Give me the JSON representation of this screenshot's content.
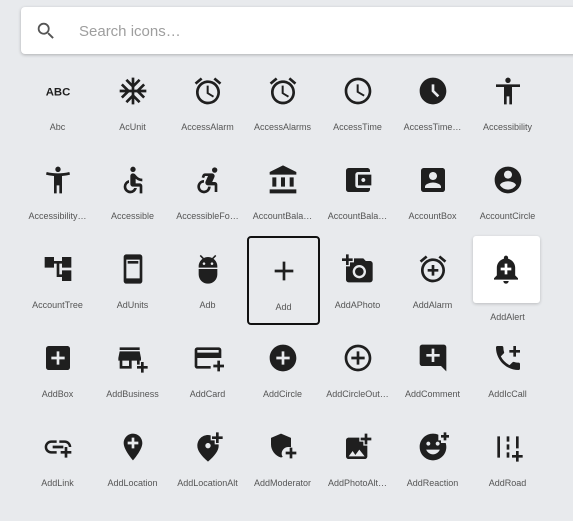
{
  "search": {
    "placeholder": "Search icons…",
    "value": ""
  },
  "icons": [
    {
      "label": "Abc",
      "icon": "abc-icon"
    },
    {
      "label": "AcUnit",
      "icon": "ac-unit-icon"
    },
    {
      "label": "AccessAlarm",
      "icon": "access-alarm-icon"
    },
    {
      "label": "AccessAlarms",
      "icon": "access-alarms-icon"
    },
    {
      "label": "AccessTime",
      "icon": "access-time-icon"
    },
    {
      "label": "AccessTime…",
      "icon": "access-time-filled-icon"
    },
    {
      "label": "Accessibility",
      "icon": "accessibility-icon"
    },
    {
      "label": "Accessibility…",
      "icon": "accessibility-new-icon"
    },
    {
      "label": "Accessible",
      "icon": "accessible-icon"
    },
    {
      "label": "AccessibleFo…",
      "icon": "accessible-forward-icon"
    },
    {
      "label": "AccountBala…",
      "icon": "account-balance-icon"
    },
    {
      "label": "AccountBala…",
      "icon": "account-balance-wallet-icon"
    },
    {
      "label": "AccountBox",
      "icon": "account-box-icon"
    },
    {
      "label": "AccountCircle",
      "icon": "account-circle-icon"
    },
    {
      "label": "AccountTree",
      "icon": "account-tree-icon"
    },
    {
      "label": "AdUnits",
      "icon": "ad-units-icon"
    },
    {
      "label": "Adb",
      "icon": "adb-icon"
    },
    {
      "label": "Add",
      "icon": "add-icon"
    },
    {
      "label": "AddAPhoto",
      "icon": "add-a-photo-icon"
    },
    {
      "label": "AddAlarm",
      "icon": "add-alarm-icon"
    },
    {
      "label": "AddAlert",
      "icon": "add-alert-icon"
    },
    {
      "label": "AddBox",
      "icon": "add-box-icon"
    },
    {
      "label": "AddBusiness",
      "icon": "add-business-icon"
    },
    {
      "label": "AddCard",
      "icon": "add-card-icon"
    },
    {
      "label": "AddCircle",
      "icon": "add-circle-icon"
    },
    {
      "label": "AddCircleOut…",
      "icon": "add-circle-outline-icon"
    },
    {
      "label": "AddComment",
      "icon": "add-comment-icon"
    },
    {
      "label": "AddIcCall",
      "icon": "add-ic-call-icon"
    },
    {
      "label": "AddLink",
      "icon": "add-link-icon"
    },
    {
      "label": "AddLocation",
      "icon": "add-location-icon"
    },
    {
      "label": "AddLocationAlt",
      "icon": "add-location-alt-icon"
    },
    {
      "label": "AddModerator",
      "icon": "add-moderator-icon"
    },
    {
      "label": "AddPhotoAlt…",
      "icon": "add-photo-alternate-icon"
    },
    {
      "label": "AddReaction",
      "icon": "add-reaction-icon"
    },
    {
      "label": "AddRoad",
      "icon": "add-road-icon"
    }
  ],
  "selected_label": "Add",
  "hovered_label": "AddAlert",
  "colors": {
    "background": "#e8eaed",
    "icon": "#1f1f1f",
    "label": "#555555",
    "selected_border": "#111111",
    "hover_bg": "#ffffff"
  }
}
